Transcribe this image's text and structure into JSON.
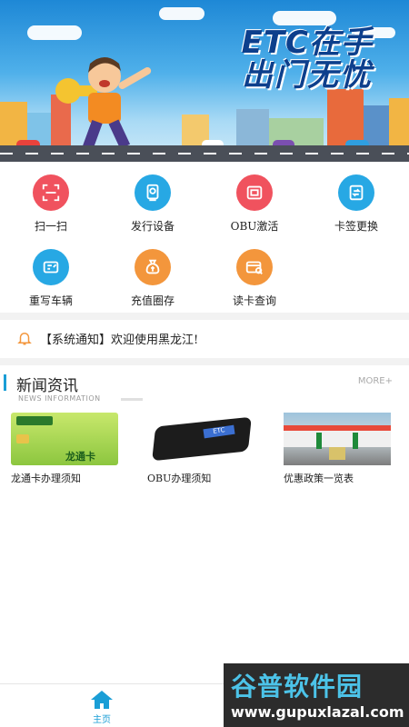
{
  "banner": {
    "line1": "ETC在手",
    "line2": "出门无忧"
  },
  "functions": [
    {
      "label": "扫一扫",
      "icon": "scan-icon",
      "color": "#f0525e"
    },
    {
      "label": "发行设备",
      "icon": "device-issue-icon",
      "color": "#27a8e4"
    },
    {
      "label": "OBU激活",
      "icon": "obu-activate-icon",
      "color": "#f0525e"
    },
    {
      "label": "卡签更换",
      "icon": "card-swap-icon",
      "color": "#27a8e4"
    },
    {
      "label": "重写车辆",
      "icon": "rewrite-vehicle-icon",
      "color": "#27a8e4"
    },
    {
      "label": "充值圈存",
      "icon": "recharge-icon",
      "color": "#f3963c"
    },
    {
      "label": "读卡查询",
      "icon": "read-card-icon",
      "color": "#f3963c"
    }
  ],
  "notice": {
    "text": "【系统通知】欢迎使用黑龙江!"
  },
  "news": {
    "title": "新闻资讯",
    "subtitle": "NEWS INFORMATION",
    "more": "MORE+",
    "items": [
      {
        "title": "龙通卡办理须知",
        "card_text": "龙通卡"
      },
      {
        "title": "OBU办理须知",
        "device_text": "ETC"
      },
      {
        "title": "优惠政策一览表"
      }
    ]
  },
  "bottom_nav": {
    "home_label": "主页"
  },
  "watermark": {
    "brand": "谷普软件园",
    "url": "www.gupuxlazal.com"
  },
  "colors": {
    "accent": "#1a9ed6",
    "red": "#f0525e",
    "blue": "#27a8e4",
    "orange": "#f3963c"
  }
}
